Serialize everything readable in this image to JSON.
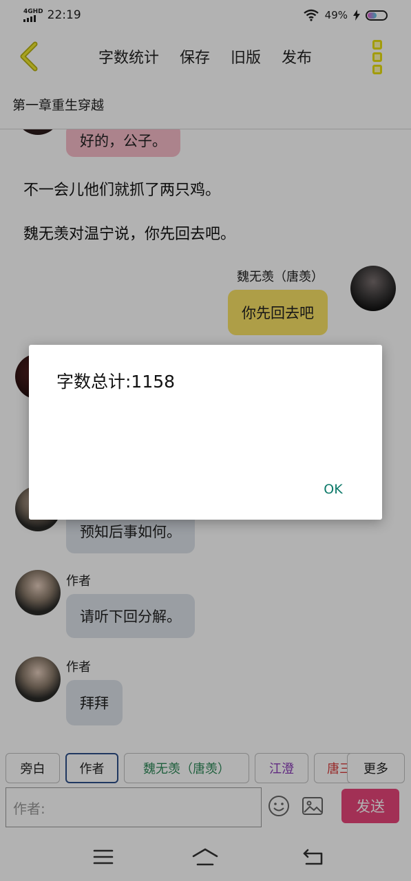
{
  "status_bar": {
    "network": "4GHD",
    "time": "22:19",
    "battery": "49%",
    "battery_level": 0.49
  },
  "toolbar": {
    "actions": [
      "字数统计",
      "保存",
      "旧版",
      "发布"
    ]
  },
  "chapter": {
    "title": "第一章重生穿越"
  },
  "chat": {
    "top_bubble": "好的，公子。",
    "narration_1": "不一会儿他们就抓了两只鸡。",
    "narration_2": "魏无羡对温宁说，你先回去吧。",
    "right_sender": "魏无羡（唐羡）",
    "right_bubble": "你先回去吧",
    "bubble_predict": "预知后事如何。",
    "author_name": "作者",
    "bubble_next": "请听下回分解。",
    "bubble_bye": "拜拜"
  },
  "roles": [
    "旁白",
    "作者",
    "魏无羡（唐羡）",
    "江澄",
    "唐三",
    "更多"
  ],
  "input": {
    "placeholder": "作者:",
    "send_label": "发送"
  },
  "dialog": {
    "message": "字数总计:1158",
    "ok_label": "OK"
  },
  "colors": {
    "accent_yellow": "#fae266",
    "send_pink": "#e8457a",
    "ok_teal": "#0e7a6a",
    "role_jiangcheng": "#8a3bb8",
    "role_tangsan": "#d83a3a"
  },
  "icons": {
    "back": "chevron-left-icon",
    "menu": "menu-icon",
    "emoji": "emoji-icon",
    "image": "image-icon",
    "nav_menu": "hamburger-icon",
    "nav_home": "home-icon",
    "nav_back": "back-icon"
  }
}
